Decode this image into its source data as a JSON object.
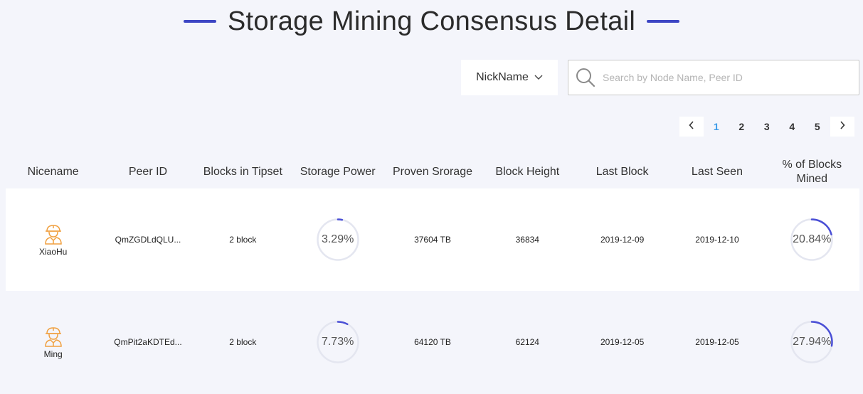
{
  "page": {
    "title": "Storage Mining Consensus Detail",
    "accent_color": "#3d46c4"
  },
  "filter": {
    "select_value": "NickName",
    "search_placeholder": "Search by Node Name, Peer ID",
    "search_value": ""
  },
  "pagination": {
    "prev_icon": "chevron-left-icon",
    "next_icon": "chevron-right-icon",
    "pages": [
      "1",
      "2",
      "3",
      "4",
      "5"
    ],
    "current": "1",
    "active_color": "#3c9be8"
  },
  "table": {
    "headers": {
      "nickname": "Nicename",
      "peer_id": "Peer ID",
      "blocks_in_tipset": "Blocks in Tipset",
      "storage_power": "Storage Power",
      "proven_storage": "Proven Srorage",
      "block_height": "Block Height",
      "last_block": "Last Block",
      "last_seen": "Last Seen",
      "pct_blocks_line1": "% of Blocks",
      "pct_blocks_line2": "Mined"
    },
    "rows": [
      {
        "avatar_icon": "miner-avatar-icon",
        "nickname": "XiaoHu",
        "peer_id": "QmZGDLdQLU...",
        "blocks_in_tipset": "2 block",
        "storage_power_label": "3.29%",
        "storage_power_value": 0.0329,
        "proven_storage": "37604 TB",
        "block_height": "36834",
        "last_block": "2019-12-09",
        "last_seen": "2019-12-10",
        "pct_blocks_label": "20.84%",
        "pct_blocks_value": 0.2084
      },
      {
        "avatar_icon": "miner-avatar-icon",
        "nickname": "Ming",
        "peer_id": "QmPit2aKDTEd...",
        "blocks_in_tipset": "2 block",
        "storage_power_label": "7.73%",
        "storage_power_value": 0.0773,
        "proven_storage": "64120 TB",
        "block_height": "62124",
        "last_block": "2019-12-05",
        "last_seen": "2019-12-05",
        "pct_blocks_label": "27.94%",
        "pct_blocks_value": 0.2794
      }
    ],
    "ring_track_color": "#e4e6f0",
    "ring_fill_color": "#4a4fd6"
  }
}
